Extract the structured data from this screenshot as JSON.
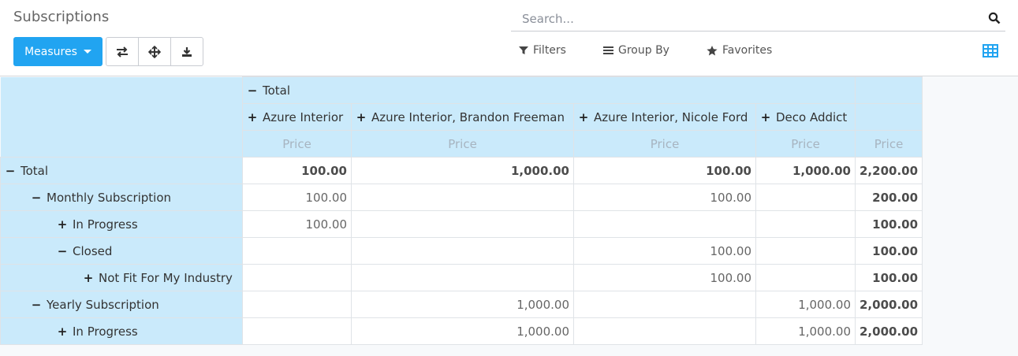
{
  "page": {
    "title": "Subscriptions"
  },
  "toolbar": {
    "measures_label": "Measures",
    "flip_icon": "flip-axis-icon",
    "expand_icon": "expand-all-icon",
    "download_icon": "download-icon"
  },
  "search": {
    "placeholder": "Search..."
  },
  "filters": {
    "filters_label": "Filters",
    "groupby_label": "Group By",
    "favorites_label": "Favorites"
  },
  "colors": {
    "primary": "#21a4f1",
    "header_bg": "#caeafb"
  },
  "pivot": {
    "col_total_label": "Total",
    "col_headers": [
      "Azure Interior",
      "Azure Interior, Brandon Freeman",
      "Azure Interior, Nicole Ford",
      "Deco Addict"
    ],
    "measure_label": "Price",
    "rows": [
      {
        "label": "Total",
        "sym": "−",
        "values": [
          "100.00",
          "1,000.00",
          "100.00",
          "1,000.00",
          "2,200.00"
        ]
      },
      {
        "label": "Monthly Subscription",
        "sym": "−",
        "values": [
          "100.00",
          "",
          "100.00",
          "",
          "200.00"
        ]
      },
      {
        "label": "In Progress",
        "sym": "+",
        "values": [
          "100.00",
          "",
          "",
          "",
          "100.00"
        ]
      },
      {
        "label": "Closed",
        "sym": "−",
        "values": [
          "",
          "",
          "100.00",
          "",
          "100.00"
        ]
      },
      {
        "label": "Not Fit For My Industry",
        "sym": "+",
        "values": [
          "",
          "",
          "100.00",
          "",
          "100.00"
        ]
      },
      {
        "label": "Yearly Subscription",
        "sym": "−",
        "values": [
          "",
          "1,000.00",
          "",
          "1,000.00",
          "2,000.00"
        ]
      },
      {
        "label": "In Progress",
        "sym": "+",
        "values": [
          "",
          "1,000.00",
          "",
          "1,000.00",
          "2,000.00"
        ]
      }
    ]
  }
}
